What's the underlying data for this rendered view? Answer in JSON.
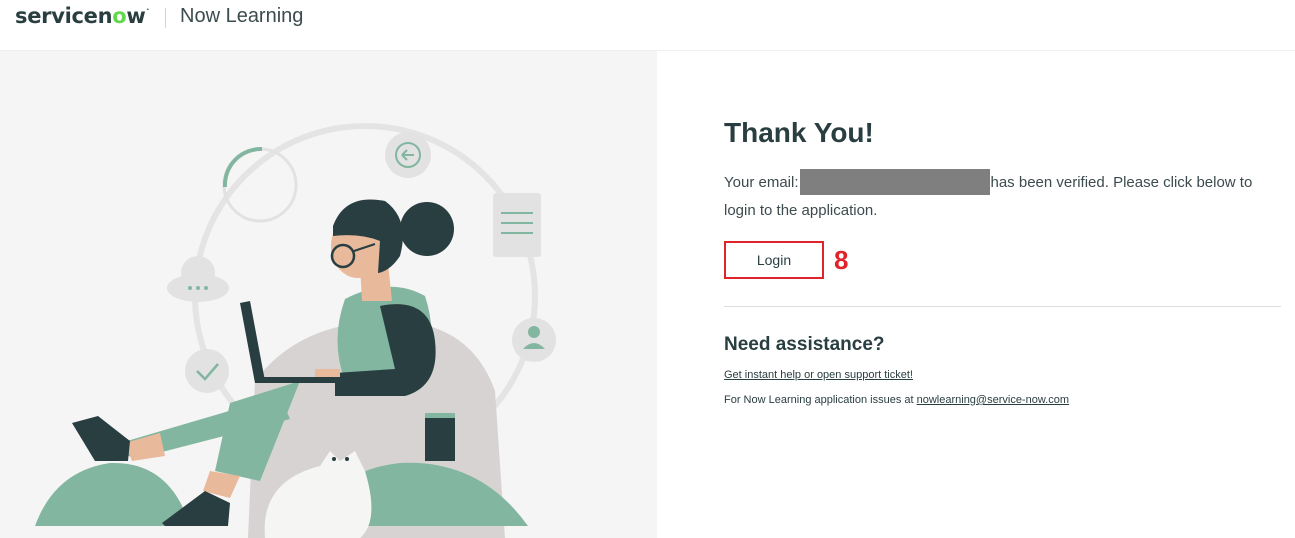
{
  "header": {
    "logo_text": "servicenow",
    "app_name": "Now Learning"
  },
  "hero": {
    "illustration": "woman-with-laptop-icon"
  },
  "main": {
    "title": "Thank You!",
    "message_prefix": "Your email:",
    "message_suffix": "has been verified. Please click below to login to the application.",
    "login_label": "Login",
    "annotation": "8"
  },
  "assistance": {
    "title": "Need assistance?",
    "help_link": "Get instant help or open support ticket!",
    "issues_text": "For Now Learning application issues at",
    "issues_email": "nowlearning@service-now.com"
  },
  "colors": {
    "brand_green": "#62d84e",
    "illustration_green": "#82b6a0",
    "dark_teal": "#293e40",
    "annotation_red": "#e0242c"
  }
}
